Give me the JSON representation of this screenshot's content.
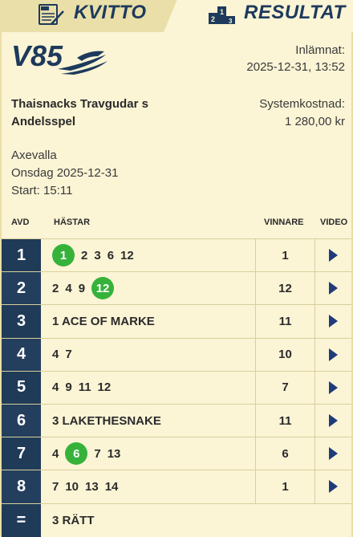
{
  "tabs": {
    "kvitto": {
      "label": "KVITTO",
      "icon": "receipt-icon"
    },
    "resultat": {
      "label": "RESULTAT",
      "icon": "podium-icon"
    }
  },
  "receipt": {
    "logo": "V85",
    "submitted_label": "Inlämnat:",
    "submitted_value": "2025-12-31, 13:52",
    "team_line1": "Thaisnacks Travgudar s",
    "team_line2": "Andelsspel",
    "cost_label": "Systemkostnad:",
    "cost_value": "1 280,00 kr",
    "track": "Axevalla",
    "date": "Onsdag 2025-12-31",
    "start": "Start: 15:11"
  },
  "table": {
    "headers": {
      "avd": "AVD",
      "horses": "HÄSTAR",
      "winner": "VINNARE",
      "video": "VIDEO"
    },
    "rows": [
      {
        "avd": "1",
        "horses": [
          "1",
          "2",
          "3",
          "6",
          "12"
        ],
        "hit": "1",
        "winner": "1"
      },
      {
        "avd": "2",
        "horses": [
          "2",
          "4",
          "9",
          "12"
        ],
        "hit": "12",
        "winner": "12"
      },
      {
        "avd": "3",
        "horses": [
          "1 ACE OF MARKE"
        ],
        "hit": "",
        "winner": "11"
      },
      {
        "avd": "4",
        "horses": [
          "4",
          "7"
        ],
        "hit": "",
        "winner": "10"
      },
      {
        "avd": "5",
        "horses": [
          "4",
          "9",
          "11",
          "12"
        ],
        "hit": "",
        "winner": "7"
      },
      {
        "avd": "6",
        "horses": [
          "3 LAKETHESNAKE"
        ],
        "hit": "",
        "winner": "11"
      },
      {
        "avd": "7",
        "horses": [
          "4",
          "6",
          "7",
          "13"
        ],
        "hit": "6",
        "winner": "6"
      },
      {
        "avd": "8",
        "horses": [
          "7",
          "10",
          "13",
          "14"
        ],
        "hit": "",
        "winner": "1"
      }
    ],
    "total": {
      "symbol": "=",
      "text": "3 RÄTT"
    }
  },
  "colors": {
    "navy": "#1f3b58",
    "win_green": "#36b23a",
    "cream": "#fbf4d5"
  }
}
